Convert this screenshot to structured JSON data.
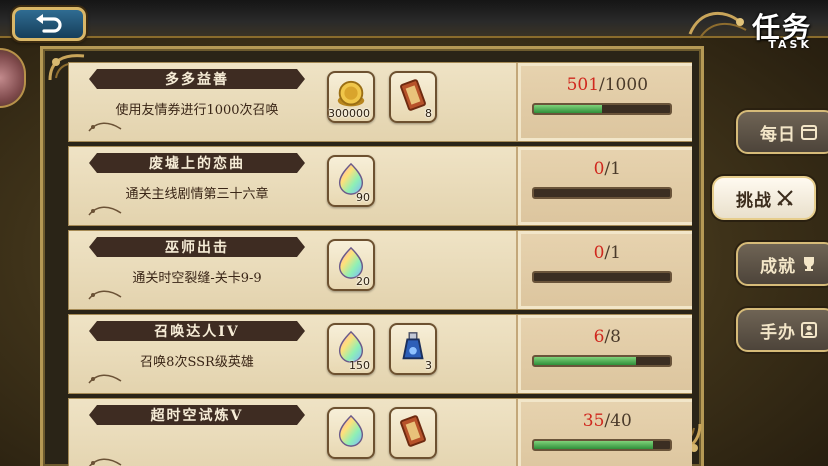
{
  "header": {
    "title": "任务",
    "subtitle": "TASK"
  },
  "nav": {
    "back_icon": "return-arrow-icon"
  },
  "tabs": [
    {
      "label": "每日",
      "icon": "calendar-icon",
      "active": false
    },
    {
      "label": "挑战",
      "icon": "crossed-swords-icon",
      "active": true
    },
    {
      "label": "成就",
      "icon": "trophy-icon",
      "active": false
    },
    {
      "label": "手办",
      "icon": "figure-icon",
      "active": false
    }
  ],
  "quests": [
    {
      "title": "多多益善",
      "description": "使用友情券进行1000次召唤",
      "rewards": [
        {
          "icon": "gold-coin-icon",
          "qty": "300000"
        },
        {
          "icon": "summon-ticket-icon",
          "qty": "8"
        }
      ],
      "current": "501",
      "target": "/1000",
      "progress": 0.501
    },
    {
      "title": "废墟上的恋曲",
      "description": "通关主线剧情第三十六章",
      "rewards": [
        {
          "icon": "rainbow-crystal-icon",
          "qty": "90"
        }
      ],
      "current": "0",
      "target": "/1",
      "progress": 0
    },
    {
      "title": "巫师出击",
      "description": "通关时空裂缝-关卡9-9",
      "rewards": [
        {
          "icon": "rainbow-crystal-icon",
          "qty": "20"
        }
      ],
      "current": "0",
      "target": "/1",
      "progress": 0
    },
    {
      "title": "召唤达人IV",
      "description": "召唤8次SSR级英雄",
      "rewards": [
        {
          "icon": "rainbow-crystal-icon",
          "qty": "150"
        },
        {
          "icon": "potion-bottle-icon",
          "qty": "3"
        }
      ],
      "current": "6",
      "target": "/8",
      "progress": 0.75
    },
    {
      "title": "超时空试炼V",
      "description": "",
      "rewards": [
        {
          "icon": "rainbow-crystal-icon",
          "qty": ""
        },
        {
          "icon": "summon-ticket-icon",
          "qty": ""
        }
      ],
      "current": "35",
      "target": "/40",
      "progress": 0.875
    }
  ],
  "colors": {
    "current_value": "#d0281e",
    "progress_fill": "#3fa64a",
    "banner": "#3e2c22"
  }
}
